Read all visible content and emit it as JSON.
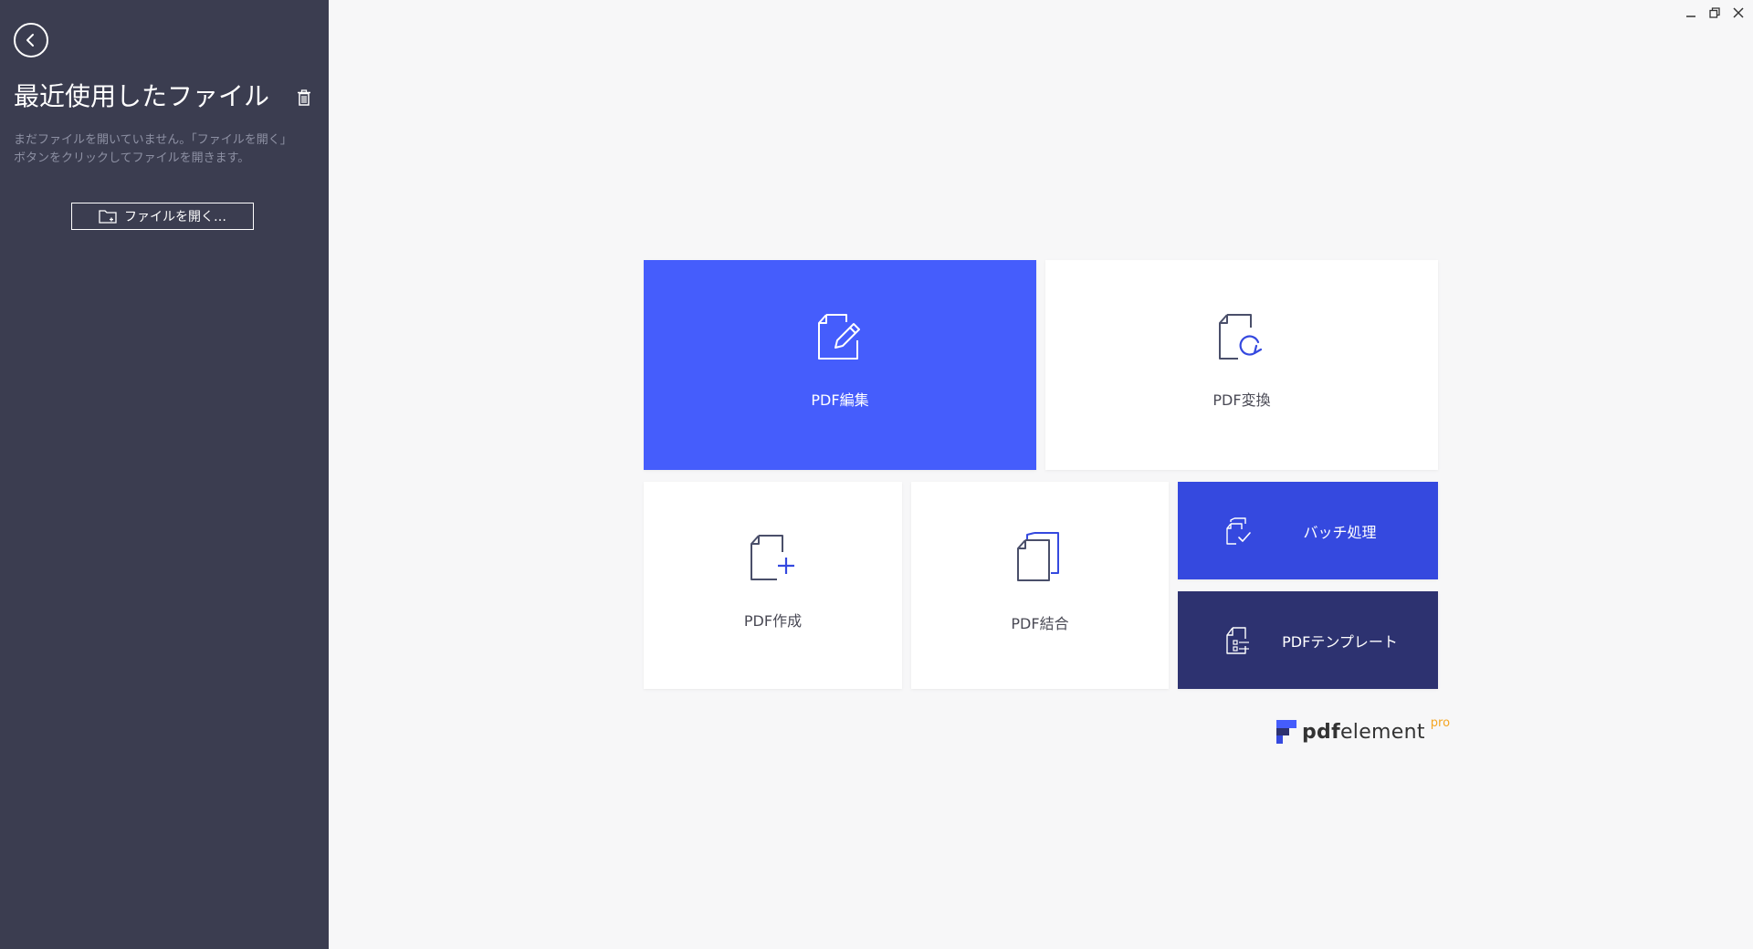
{
  "sidebar": {
    "title": "最近使用したファイル",
    "description": "まだファイルを開いていません。「ファイルを開く」ボタンをクリックしてファイルを開きます。",
    "open_button_label": "ファイルを開く…",
    "icons": {
      "back": "back-arrow-icon",
      "trash": "trash-icon",
      "open": "folder-open-icon"
    }
  },
  "window_controls": {
    "icons": [
      "minimize-icon",
      "restore-icon",
      "close-icon"
    ]
  },
  "tiles": {
    "edit": {
      "label": "PDF編集",
      "icon": "edit-document-icon"
    },
    "convert": {
      "label": "PDF変換",
      "icon": "convert-document-icon"
    },
    "create": {
      "label": "PDF作成",
      "icon": "create-document-icon"
    },
    "merge": {
      "label": "PDF結合",
      "icon": "merge-documents-icon"
    },
    "batch": {
      "label": "バッチ処理",
      "icon": "batch-process-icon"
    },
    "template": {
      "label": "PDFテンプレート",
      "icon": "template-icon"
    }
  },
  "logo": {
    "bold": "pdf",
    "regular": "element",
    "suffix": "pro"
  },
  "colors": {
    "sidebar_bg": "#3b3d50",
    "primary_blue": "#455dfc",
    "batch_blue": "#3549df",
    "template_navy": "#2d3270",
    "pro_orange": "#f5a623"
  }
}
